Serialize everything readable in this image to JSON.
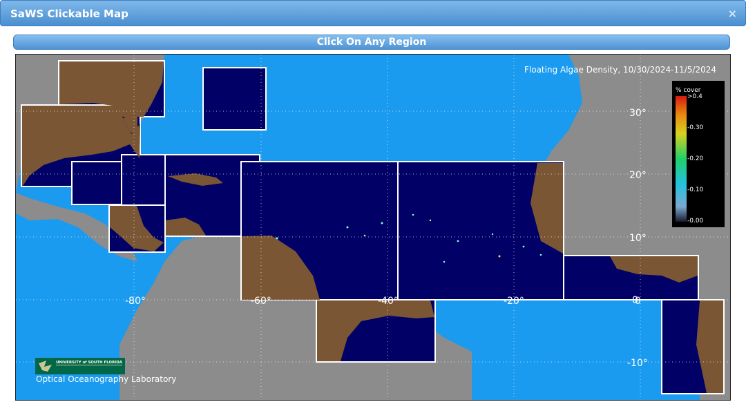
{
  "window": {
    "title": "SaWS Clickable Map",
    "close_glyph": "×"
  },
  "banner": {
    "label": "Click On Any Region"
  },
  "map": {
    "title": "Floating Algae Density, 10/30/2024-11/5/2024",
    "colors": {
      "ocean": "#1a9bf0",
      "land": "#8c8c8c",
      "region": "#000066",
      "region_land": "#7a5634",
      "box": "#ffffff"
    },
    "lat_labels": [
      "30°",
      "20°",
      "10°",
      "0",
      "-10°"
    ],
    "lon_labels": [
      "-80°",
      "-60°",
      "-40°",
      "-20°",
      "0"
    ],
    "colorbar": {
      "title": "% cover",
      "ticks": [
        ">0.4",
        "-0.30",
        "-0.20",
        "-0.10",
        "-0.00"
      ]
    },
    "logo": {
      "university": "UNIVERSITY of SOUTH FLORIDA",
      "lab": "Optical Oceanography Laboratory"
    }
  }
}
